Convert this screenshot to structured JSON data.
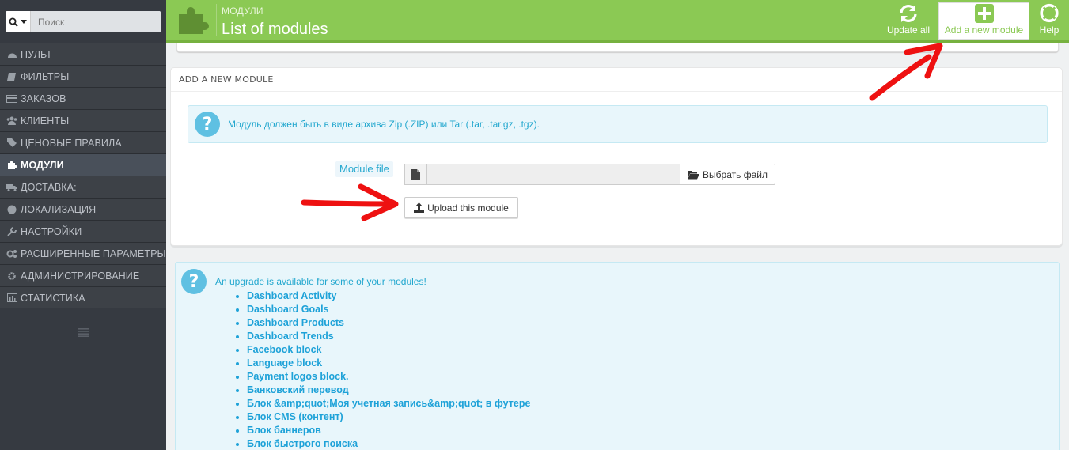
{
  "sidebar": {
    "search_placeholder": "Поиск",
    "items": [
      {
        "label": "ПУЛЬТ",
        "icon": "dashboard-icon"
      },
      {
        "label": "ФИЛЬТРЫ",
        "icon": "book-icon"
      },
      {
        "label": "ЗАКАЗОВ",
        "icon": "credit-card-icon"
      },
      {
        "label": "КЛИЕНТЫ",
        "icon": "users-icon"
      },
      {
        "label": "ЦЕНОВЫЕ ПРАВИЛА",
        "icon": "tags-icon"
      },
      {
        "label": "МОДУЛИ",
        "icon": "puzzle-icon"
      },
      {
        "label": "ДОСТАВКА:",
        "icon": "truck-icon"
      },
      {
        "label": "ЛОКАЛИЗАЦИЯ",
        "icon": "globe-icon"
      },
      {
        "label": "НАСТРОЙКИ",
        "icon": "wrench-icon"
      },
      {
        "label": "РАСШИРЕННЫЕ ПАРАМЕТРЫ",
        "icon": "cogs-icon"
      },
      {
        "label": "АДМИНИСТРИРОВАНИЕ",
        "icon": "cog-icon"
      },
      {
        "label": "СТАТИСТИКА",
        "icon": "bar-chart-icon"
      }
    ],
    "active_index": 5
  },
  "header": {
    "breadcrumb": "МОДУЛИ",
    "title": "List of modules",
    "update_all": "Update all",
    "add_module": "Add a new module",
    "help": "Help"
  },
  "panel": {
    "heading": "ADD A NEW MODULE",
    "info": "Модуль должен быть в виде архива Zip (.ZIP) или Tar (.tar, .tar.gz, .tgz).",
    "file_label": "Module file",
    "browse": "Выбрать файл",
    "upload": "Upload this module"
  },
  "upgrade": {
    "message": "An upgrade is available for some of your modules!",
    "modules": [
      "Dashboard Activity",
      "Dashboard Goals",
      "Dashboard Products",
      "Dashboard Trends",
      "Facebook block",
      "Language block",
      "Payment logos block.",
      "Банковский перевод",
      "Блок &amp;quot;Моя учетная запись&amp;quot; в футере",
      "Блок CMS (контент)",
      "Блок баннеров",
      "Блок быстрого поиска"
    ]
  },
  "colors": {
    "header_green": "#8bc954",
    "sidebar_bg": "#363a41",
    "info_blue": "#22a7ce",
    "arrow_red": "#ee1111"
  }
}
